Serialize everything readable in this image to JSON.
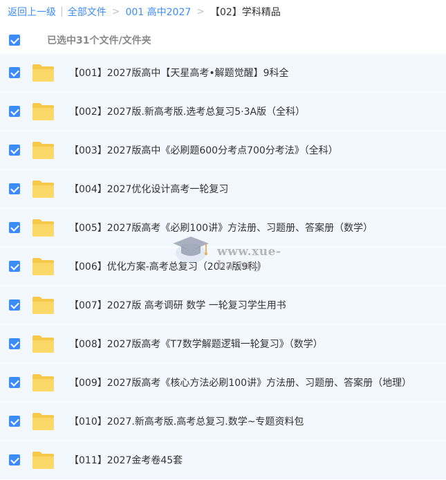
{
  "breadcrumb": {
    "back": "返回上一级",
    "sep1": "|",
    "all_files": "全部文件",
    "gt1": ">",
    "crumb1": "001 高中2027",
    "gt2": ">",
    "current": "【02】学科精品"
  },
  "selection": {
    "label": "已选中31个文件/文件夹",
    "all_checked": true
  },
  "files": [
    {
      "name": "【001】2027版高中【天星高考•解题觉醒】9科全",
      "checked": true
    },
    {
      "name": "【002】2027版.新高考版.选考总复习5·3A版（全科）",
      "checked": true
    },
    {
      "name": "【003】2027版高中《必刷题600分考点700分考法》（全科）",
      "checked": true
    },
    {
      "name": "【004】2027优化设计高考一轮复习",
      "checked": true
    },
    {
      "name": "【005】2027版高考《必刷100讲》方法册、习题册、答案册（数学）",
      "checked": true
    },
    {
      "name": "【006】优化方案-高考总复习（2027版9科）",
      "checked": true
    },
    {
      "name": "【007】2027版 高考调研 数学 一轮复习学生用书",
      "checked": true
    },
    {
      "name": "【008】2027版高考《T7数学解题逻辑一轮复习》（数学）",
      "checked": true
    },
    {
      "name": "【009】2027版高考《核心方法必刷100讲》方法册、习题册、答案册（地理）",
      "checked": true
    },
    {
      "name": "【010】2027.新高考版.高考总复习.数学~专题资料包",
      "checked": true
    },
    {
      "name": "【011】2027金考卷45套",
      "checked": true
    }
  ],
  "watermark": {
    "text": "www.xue-ba.org",
    "icon": "graduation-cap-icon"
  },
  "colors": {
    "accent": "#3b8cff",
    "folder": "#f9d45c",
    "row_bg": "#f3f8ff"
  }
}
